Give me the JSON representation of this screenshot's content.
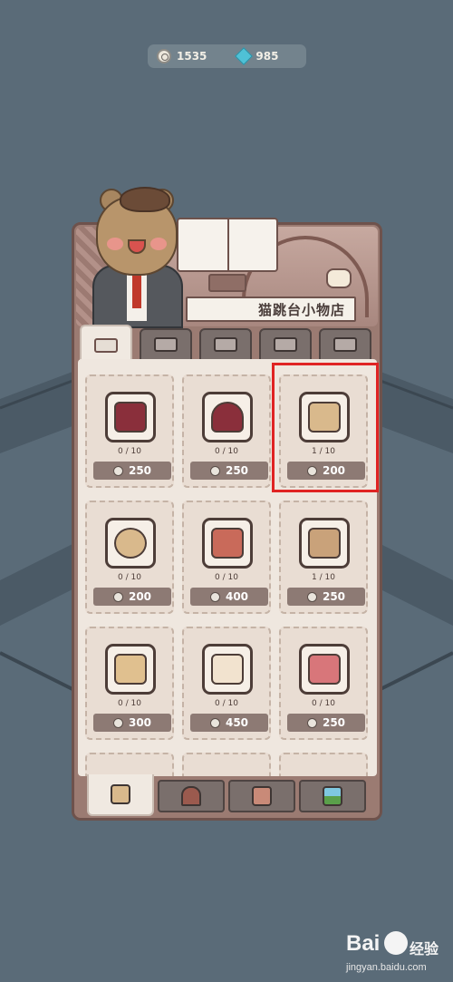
{
  "currency": {
    "coins": "1535",
    "gems": "985"
  },
  "shop": {
    "title": "猫跳台小物店"
  },
  "category_tabs": [
    {
      "icon": "all-items-icon",
      "active": true
    },
    {
      "icon": "table-icon",
      "active": false
    },
    {
      "icon": "cabinet-icon",
      "active": false
    },
    {
      "icon": "chair-icon",
      "active": false
    },
    {
      "icon": "bed-icon",
      "active": false
    }
  ],
  "items": [
    {
      "name": "coat-stand",
      "count": "0 / 10",
      "price": "250"
    },
    {
      "name": "round-stool",
      "count": "0 / 10",
      "price": "250"
    },
    {
      "name": "wooden-chair",
      "count": "1 / 10",
      "price": "200"
    },
    {
      "name": "round-table",
      "count": "0 / 10",
      "price": "200"
    },
    {
      "name": "desk-lamp-table",
      "count": "0 / 10",
      "price": "400"
    },
    {
      "name": "side-table-letter",
      "count": "1 / 10",
      "price": "250"
    },
    {
      "name": "wardrobe",
      "count": "0 / 10",
      "price": "300"
    },
    {
      "name": "bed",
      "count": "0 / 10",
      "price": "450"
    },
    {
      "name": "armchair",
      "count": "0 / 10",
      "price": "250"
    }
  ],
  "bottom_tabs": [
    {
      "icon": "furniture-icon",
      "active": true
    },
    {
      "icon": "window-icon",
      "active": false
    },
    {
      "icon": "floor-pattern-icon",
      "active": false
    },
    {
      "icon": "wallpaper-landscape-icon",
      "active": false
    }
  ],
  "watermark": {
    "brand": "Bai",
    "cn": "经验",
    "url": "jingyan.baidu.com"
  },
  "colors": {
    "background": "#5a6b78",
    "panel": "#efe7df",
    "price_pill": "#8d7a74",
    "highlight": "#e02424"
  }
}
